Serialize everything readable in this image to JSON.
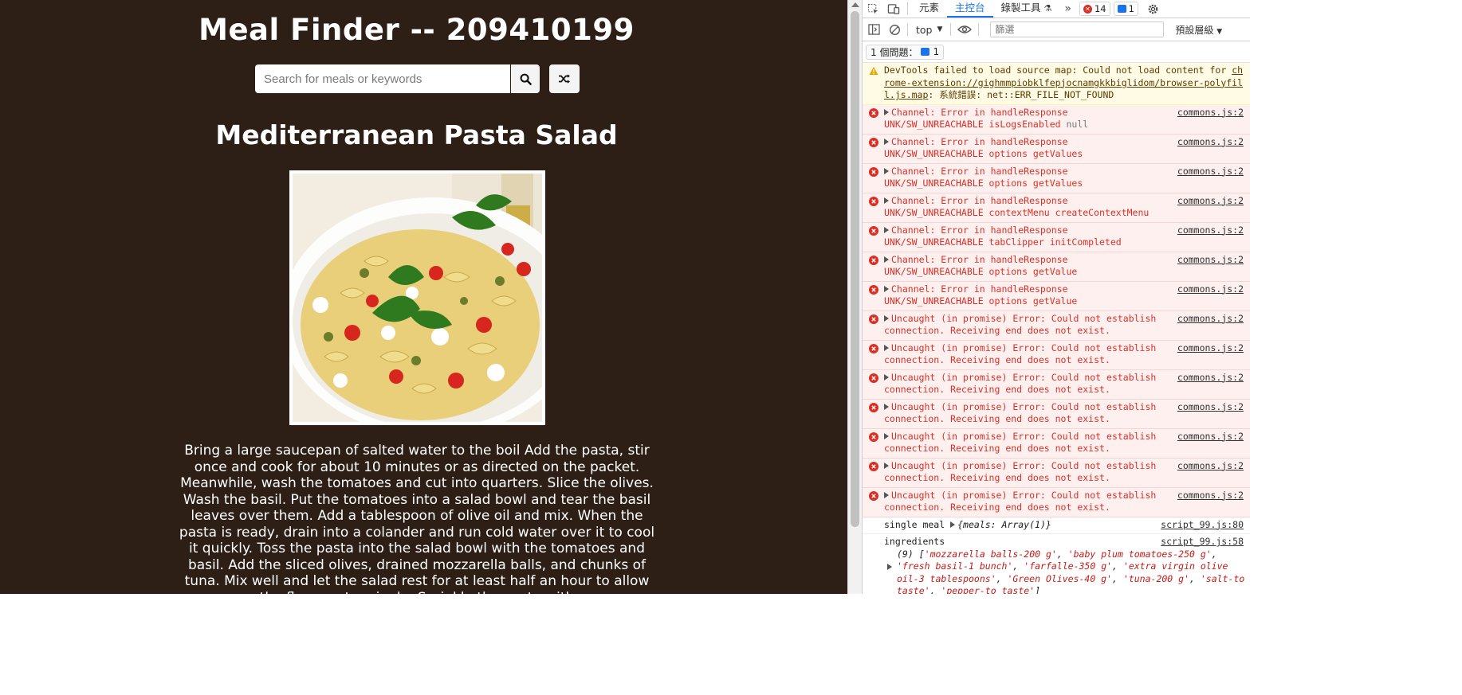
{
  "app": {
    "title": "Meal Finder -- 209410199",
    "search": {
      "placeholder": "Search for meals or keywords",
      "value": ""
    },
    "search_icon": "search-icon",
    "random_icon": "shuffle-icon",
    "meal": {
      "title": "Mediterranean Pasta Salad",
      "image_alt": "Mediterranean Pasta Salad",
      "instructions": "Bring a large saucepan of salted water to the boil Add the pasta, stir once and cook for about 10 minutes or as directed on the packet. Meanwhile, wash the tomatoes and cut into quarters. Slice the olives. Wash the basil. Put the tomatoes into a salad bowl and tear the basil leaves over them. Add a tablespoon of olive oil and mix. When the pasta is ready, drain into a colander and run cold water over it to cool it quickly. Toss the pasta into the salad bowl with the tomatoes and basil. Add the sliced olives, drained mozzarella balls, and chunks of tuna. Mix well and let the salad rest for at least half an hour to allow the flavours to mingle. Sprinkle the pasta with"
    },
    "colors": {
      "background": "#2d1f16",
      "text": "#ffffff"
    }
  },
  "devtools": {
    "tabs": [
      "元素",
      "主控台",
      "錄製工具"
    ],
    "active_tab": "主控台",
    "error_count": "14",
    "message_count": "1",
    "context": "top",
    "filter_placeholder": "篩選",
    "levels": "預設層級",
    "issues_label": "1 個問題：",
    "issues_count": "1",
    "warning": {
      "prefix": "DevTools failed to load source map: Could not load content for ",
      "url": "chrome-extension://gighmmpiobklfepjocnamgkkbiglidom/browser-polyfill.js.map",
      "suffix": ": 系統錯誤: net::ERR_FILE_NOT_FOUND"
    },
    "channel_errors": [
      {
        "line1": "Channel: Error in handleResponse",
        "line2": "UNK/SW_UNREACHABLE isLogsEnabled ",
        "extra": "null",
        "src": "commons.js:2"
      },
      {
        "line1": "Channel: Error in handleResponse",
        "line2": "UNK/SW_UNREACHABLE options getValues",
        "extra": "",
        "src": "commons.js:2"
      },
      {
        "line1": "Channel: Error in handleResponse",
        "line2": "UNK/SW_UNREACHABLE options getValues",
        "extra": "",
        "src": "commons.js:2"
      },
      {
        "line1": "Channel: Error in handleResponse",
        "line2": "UNK/SW_UNREACHABLE contextMenu createContextMenu",
        "extra": "",
        "src": "commons.js:2"
      },
      {
        "line1": "Channel: Error in handleResponse",
        "line2": "UNK/SW_UNREACHABLE tabClipper initCompleted",
        "extra": "",
        "src": "commons.js:2"
      },
      {
        "line1": "Channel: Error in handleResponse",
        "line2": "UNK/SW_UNREACHABLE options getValue",
        "extra": "",
        "src": "commons.js:2"
      },
      {
        "line1": "Channel: Error in handleResponse",
        "line2": "UNK/SW_UNREACHABLE options getValue",
        "extra": "",
        "src": "commons.js:2"
      }
    ],
    "promise_error": {
      "line1": "Uncaught (in promise) Error: Could not establish",
      "line2": "connection. Receiving end does not exist.",
      "src": "commons.js:2"
    },
    "promise_error_count": 7,
    "log_single_meal": {
      "label": "single meal ",
      "value": "{meals: Array(1)}",
      "src": "script_99.js:80"
    },
    "log_ingredients": {
      "label": "ingredients",
      "src": "script_99.js:58",
      "count": "(9) ",
      "items": [
        "mozzarella balls-200 g",
        "baby plum tomatoes-250 g",
        "fresh basil-1  bunch",
        "farfalle-350 g",
        "extra virgin olive oil-3  tablespoons",
        "Green Olives-40 g",
        "tuna-200 g",
        "salt-to taste",
        "pepper-to taste"
      ]
    }
  }
}
